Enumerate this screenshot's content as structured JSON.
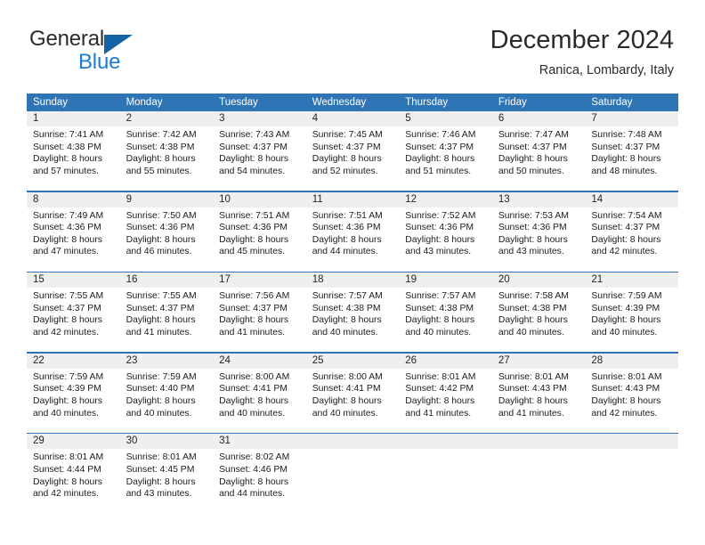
{
  "brand": {
    "word_one": "General",
    "word_two": "Blue",
    "triangle_color": "#1464a5",
    "blue_color": "#1a7fd4"
  },
  "header": {
    "month_title": "December 2024",
    "location": "Ranica, Lombardy, Italy"
  },
  "theme": {
    "header_blue": "#2f75b5",
    "number_strip": "#efefef",
    "cell_background": "#ffffff"
  },
  "day_names": [
    "Sunday",
    "Monday",
    "Tuesday",
    "Wednesday",
    "Thursday",
    "Friday",
    "Saturday"
  ],
  "weeks": [
    {
      "numbers": [
        "1",
        "2",
        "3",
        "4",
        "5",
        "6",
        "7"
      ],
      "cells": [
        {
          "l1": "Sunrise: 7:41 AM",
          "l2": "Sunset: 4:38 PM",
          "l3": "Daylight: 8 hours",
          "l4": "and 57 minutes."
        },
        {
          "l1": "Sunrise: 7:42 AM",
          "l2": "Sunset: 4:38 PM",
          "l3": "Daylight: 8 hours",
          "l4": "and 55 minutes."
        },
        {
          "l1": "Sunrise: 7:43 AM",
          "l2": "Sunset: 4:37 PM",
          "l3": "Daylight: 8 hours",
          "l4": "and 54 minutes."
        },
        {
          "l1": "Sunrise: 7:45 AM",
          "l2": "Sunset: 4:37 PM",
          "l3": "Daylight: 8 hours",
          "l4": "and 52 minutes."
        },
        {
          "l1": "Sunrise: 7:46 AM",
          "l2": "Sunset: 4:37 PM",
          "l3": "Daylight: 8 hours",
          "l4": "and 51 minutes."
        },
        {
          "l1": "Sunrise: 7:47 AM",
          "l2": "Sunset: 4:37 PM",
          "l3": "Daylight: 8 hours",
          "l4": "and 50 minutes."
        },
        {
          "l1": "Sunrise: 7:48 AM",
          "l2": "Sunset: 4:37 PM",
          "l3": "Daylight: 8 hours",
          "l4": "and 48 minutes."
        }
      ]
    },
    {
      "numbers": [
        "8",
        "9",
        "10",
        "11",
        "12",
        "13",
        "14"
      ],
      "cells": [
        {
          "l1": "Sunrise: 7:49 AM",
          "l2": "Sunset: 4:36 PM",
          "l3": "Daylight: 8 hours",
          "l4": "and 47 minutes."
        },
        {
          "l1": "Sunrise: 7:50 AM",
          "l2": "Sunset: 4:36 PM",
          "l3": "Daylight: 8 hours",
          "l4": "and 46 minutes."
        },
        {
          "l1": "Sunrise: 7:51 AM",
          "l2": "Sunset: 4:36 PM",
          "l3": "Daylight: 8 hours",
          "l4": "and 45 minutes."
        },
        {
          "l1": "Sunrise: 7:51 AM",
          "l2": "Sunset: 4:36 PM",
          "l3": "Daylight: 8 hours",
          "l4": "and 44 minutes."
        },
        {
          "l1": "Sunrise: 7:52 AM",
          "l2": "Sunset: 4:36 PM",
          "l3": "Daylight: 8 hours",
          "l4": "and 43 minutes."
        },
        {
          "l1": "Sunrise: 7:53 AM",
          "l2": "Sunset: 4:36 PM",
          "l3": "Daylight: 8 hours",
          "l4": "and 43 minutes."
        },
        {
          "l1": "Sunrise: 7:54 AM",
          "l2": "Sunset: 4:37 PM",
          "l3": "Daylight: 8 hours",
          "l4": "and 42 minutes."
        }
      ]
    },
    {
      "numbers": [
        "15",
        "16",
        "17",
        "18",
        "19",
        "20",
        "21"
      ],
      "cells": [
        {
          "l1": "Sunrise: 7:55 AM",
          "l2": "Sunset: 4:37 PM",
          "l3": "Daylight: 8 hours",
          "l4": "and 42 minutes."
        },
        {
          "l1": "Sunrise: 7:55 AM",
          "l2": "Sunset: 4:37 PM",
          "l3": "Daylight: 8 hours",
          "l4": "and 41 minutes."
        },
        {
          "l1": "Sunrise: 7:56 AM",
          "l2": "Sunset: 4:37 PM",
          "l3": "Daylight: 8 hours",
          "l4": "and 41 minutes."
        },
        {
          "l1": "Sunrise: 7:57 AM",
          "l2": "Sunset: 4:38 PM",
          "l3": "Daylight: 8 hours",
          "l4": "and 40 minutes."
        },
        {
          "l1": "Sunrise: 7:57 AM",
          "l2": "Sunset: 4:38 PM",
          "l3": "Daylight: 8 hours",
          "l4": "and 40 minutes."
        },
        {
          "l1": "Sunrise: 7:58 AM",
          "l2": "Sunset: 4:38 PM",
          "l3": "Daylight: 8 hours",
          "l4": "and 40 minutes."
        },
        {
          "l1": "Sunrise: 7:59 AM",
          "l2": "Sunset: 4:39 PM",
          "l3": "Daylight: 8 hours",
          "l4": "and 40 minutes."
        }
      ]
    },
    {
      "numbers": [
        "22",
        "23",
        "24",
        "25",
        "26",
        "27",
        "28"
      ],
      "cells": [
        {
          "l1": "Sunrise: 7:59 AM",
          "l2": "Sunset: 4:39 PM",
          "l3": "Daylight: 8 hours",
          "l4": "and 40 minutes."
        },
        {
          "l1": "Sunrise: 7:59 AM",
          "l2": "Sunset: 4:40 PM",
          "l3": "Daylight: 8 hours",
          "l4": "and 40 minutes."
        },
        {
          "l1": "Sunrise: 8:00 AM",
          "l2": "Sunset: 4:41 PM",
          "l3": "Daylight: 8 hours",
          "l4": "and 40 minutes."
        },
        {
          "l1": "Sunrise: 8:00 AM",
          "l2": "Sunset: 4:41 PM",
          "l3": "Daylight: 8 hours",
          "l4": "and 40 minutes."
        },
        {
          "l1": "Sunrise: 8:01 AM",
          "l2": "Sunset: 4:42 PM",
          "l3": "Daylight: 8 hours",
          "l4": "and 41 minutes."
        },
        {
          "l1": "Sunrise: 8:01 AM",
          "l2": "Sunset: 4:43 PM",
          "l3": "Daylight: 8 hours",
          "l4": "and 41 minutes."
        },
        {
          "l1": "Sunrise: 8:01 AM",
          "l2": "Sunset: 4:43 PM",
          "l3": "Daylight: 8 hours",
          "l4": "and 42 minutes."
        }
      ]
    },
    {
      "numbers": [
        "29",
        "30",
        "31",
        "",
        "",
        "",
        ""
      ],
      "cells": [
        {
          "l1": "Sunrise: 8:01 AM",
          "l2": "Sunset: 4:44 PM",
          "l3": "Daylight: 8 hours",
          "l4": "and 42 minutes."
        },
        {
          "l1": "Sunrise: 8:01 AM",
          "l2": "Sunset: 4:45 PM",
          "l3": "Daylight: 8 hours",
          "l4": "and 43 minutes."
        },
        {
          "l1": "Sunrise: 8:02 AM",
          "l2": "Sunset: 4:46 PM",
          "l3": "Daylight: 8 hours",
          "l4": "and 44 minutes."
        },
        {
          "l1": "",
          "l2": "",
          "l3": "",
          "l4": ""
        },
        {
          "l1": "",
          "l2": "",
          "l3": "",
          "l4": ""
        },
        {
          "l1": "",
          "l2": "",
          "l3": "",
          "l4": ""
        },
        {
          "l1": "",
          "l2": "",
          "l3": "",
          "l4": ""
        }
      ]
    }
  ]
}
